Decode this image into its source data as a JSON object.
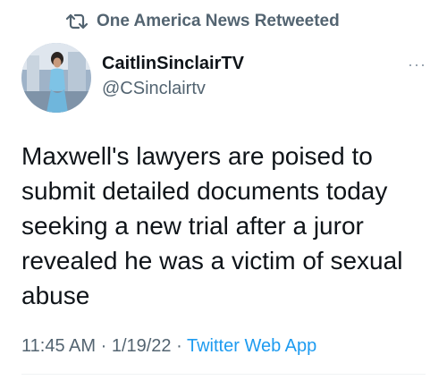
{
  "retweet": {
    "icon": "retweet-icon",
    "label": "One America News Retweeted"
  },
  "author": {
    "name": "CaitlinSinclairTV",
    "handle": "@CSinclairtv",
    "avatar": "avatar-photo"
  },
  "more_menu": {
    "icon": "more-icon",
    "label": "···"
  },
  "tweet": {
    "text": "Maxwell's lawyers are poised to\nsubmit detailed documents today\nseeking a new trial after a juror\nrevealed he was a victim of sexual\nabuse"
  },
  "meta": {
    "time": "11:45 AM",
    "sep1": "·",
    "date": "1/19/22",
    "sep2": "·",
    "source": "Twitter Web App"
  },
  "colors": {
    "text": "#0f1419",
    "muted": "#536471",
    "link": "#1d9bf0"
  }
}
